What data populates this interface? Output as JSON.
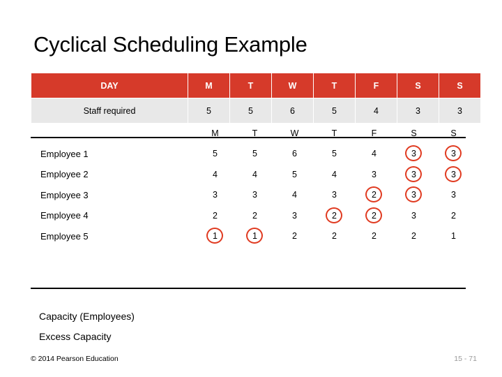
{
  "slide": {
    "title": "Cyclical Scheduling Example",
    "copyright": "© 2014 Pearson Education",
    "page_number": "15 - 71",
    "capacity_label": "Capacity (Employees)",
    "excess_label": "Excess Capacity"
  },
  "requirements_table": {
    "header": [
      "DAY",
      "M",
      "T",
      "W",
      "T",
      "F",
      "S",
      "S"
    ],
    "row_label": "Staff required",
    "values": [
      "5",
      "5",
      "6",
      "5",
      "4",
      "3",
      "3"
    ],
    "header_bg": "#d63a2a",
    "row_bg": "#e8e8e8"
  },
  "schedule": {
    "day_header": [
      "M",
      "T",
      "W",
      "T",
      "F",
      "S",
      "S"
    ],
    "circle_color": "#e03a20",
    "rows": [
      {
        "label": "Employee 1",
        "cells": [
          {
            "value": "5",
            "circled": false
          },
          {
            "value": "5",
            "circled": false
          },
          {
            "value": "6",
            "circled": false
          },
          {
            "value": "5",
            "circled": false
          },
          {
            "value": "4",
            "circled": false
          },
          {
            "value": "3",
            "circled": true
          },
          {
            "value": "3",
            "circled": true
          }
        ]
      },
      {
        "label": "Employee 2",
        "cells": [
          {
            "value": "4",
            "circled": false
          },
          {
            "value": "4",
            "circled": false
          },
          {
            "value": "5",
            "circled": false
          },
          {
            "value": "4",
            "circled": false
          },
          {
            "value": "3",
            "circled": false
          },
          {
            "value": "3",
            "circled": true
          },
          {
            "value": "3",
            "circled": true
          }
        ]
      },
      {
        "label": "Employee 3",
        "cells": [
          {
            "value": "3",
            "circled": false
          },
          {
            "value": "3",
            "circled": false
          },
          {
            "value": "4",
            "circled": false
          },
          {
            "value": "3",
            "circled": false
          },
          {
            "value": "2",
            "circled": true
          },
          {
            "value": "3",
            "circled": true
          },
          {
            "value": "3",
            "circled": false
          }
        ]
      },
      {
        "label": "Employee 4",
        "cells": [
          {
            "value": "2",
            "circled": false
          },
          {
            "value": "2",
            "circled": false
          },
          {
            "value": "3",
            "circled": false
          },
          {
            "value": "2",
            "circled": true
          },
          {
            "value": "2",
            "circled": true
          },
          {
            "value": "3",
            "circled": false
          },
          {
            "value": "2",
            "circled": false
          }
        ]
      },
      {
        "label": "Employee 5",
        "cells": [
          {
            "value": "1",
            "circled": true
          },
          {
            "value": "1",
            "circled": true
          },
          {
            "value": "2",
            "circled": false
          },
          {
            "value": "2",
            "circled": false
          },
          {
            "value": "2",
            "circled": false
          },
          {
            "value": "2",
            "circled": false
          },
          {
            "value": "1",
            "circled": false
          }
        ]
      }
    ]
  }
}
